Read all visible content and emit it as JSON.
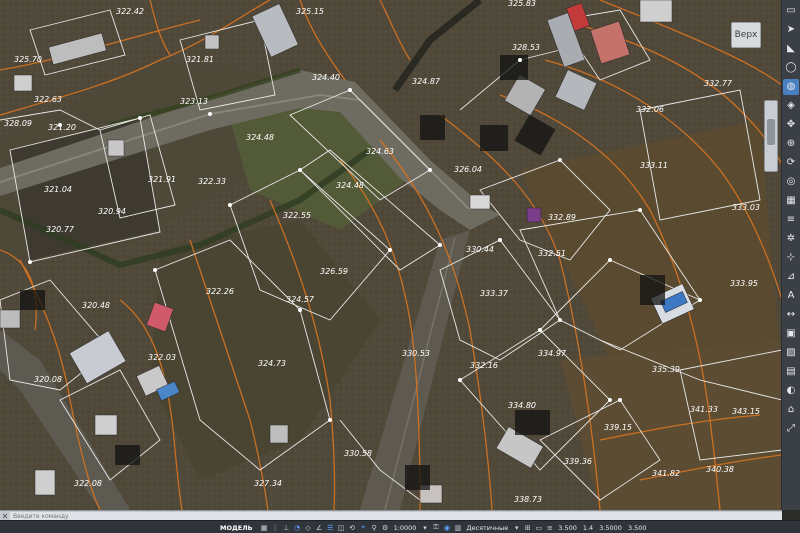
{
  "view": {
    "name_label": "Верх"
  },
  "command_line": {
    "placeholder": "Введите команду"
  },
  "status_bar": {
    "model_tab": "МОДЕЛЬ",
    "scale": "1:0000",
    "units": "Десятичные",
    "coord_1": "3.500",
    "coord_sep": "1.4",
    "coord_2": "3.5000",
    "coord_3": "3.500"
  },
  "elevations": [
    "325.15",
    "325.83",
    "328.53",
    "325.70",
    "322.63",
    "321.81",
    "323.13",
    "324.40",
    "324.87",
    "328.09",
    "321.20",
    "322.42",
    "324.48",
    "324.63",
    "326.04",
    "321.04",
    "320.94",
    "320.77",
    "321.91",
    "322.33",
    "322.55",
    "324.48",
    "326.59",
    "324.57",
    "322.26",
    "322.03",
    "324.73",
    "320.48",
    "320.08",
    "322.08",
    "327.34",
    "330.44",
    "332.89",
    "332.51",
    "333.11",
    "332.77",
    "332.06",
    "333.03",
    "333.95",
    "333.37",
    "330.53",
    "334.97",
    "332.16",
    "335.39",
    "334.80",
    "339.15",
    "339.36",
    "341.33",
    "341.82",
    "330.58",
    "338.73",
    "343.15",
    "340.38"
  ],
  "toolbar_icons": [
    "rect-icon",
    "arrow-icon",
    "circle-icon",
    "globe-icon",
    "cube-icon",
    "pan-icon",
    "zoom-icon",
    "orbit-icon",
    "steering-icon",
    "grid-icon",
    "layer-icon",
    "settings-icon",
    "snap-icon",
    "measure-icon",
    "text-icon",
    "dim-icon",
    "block-icon",
    "hatch-icon",
    "table-icon",
    "view-icon"
  ]
}
